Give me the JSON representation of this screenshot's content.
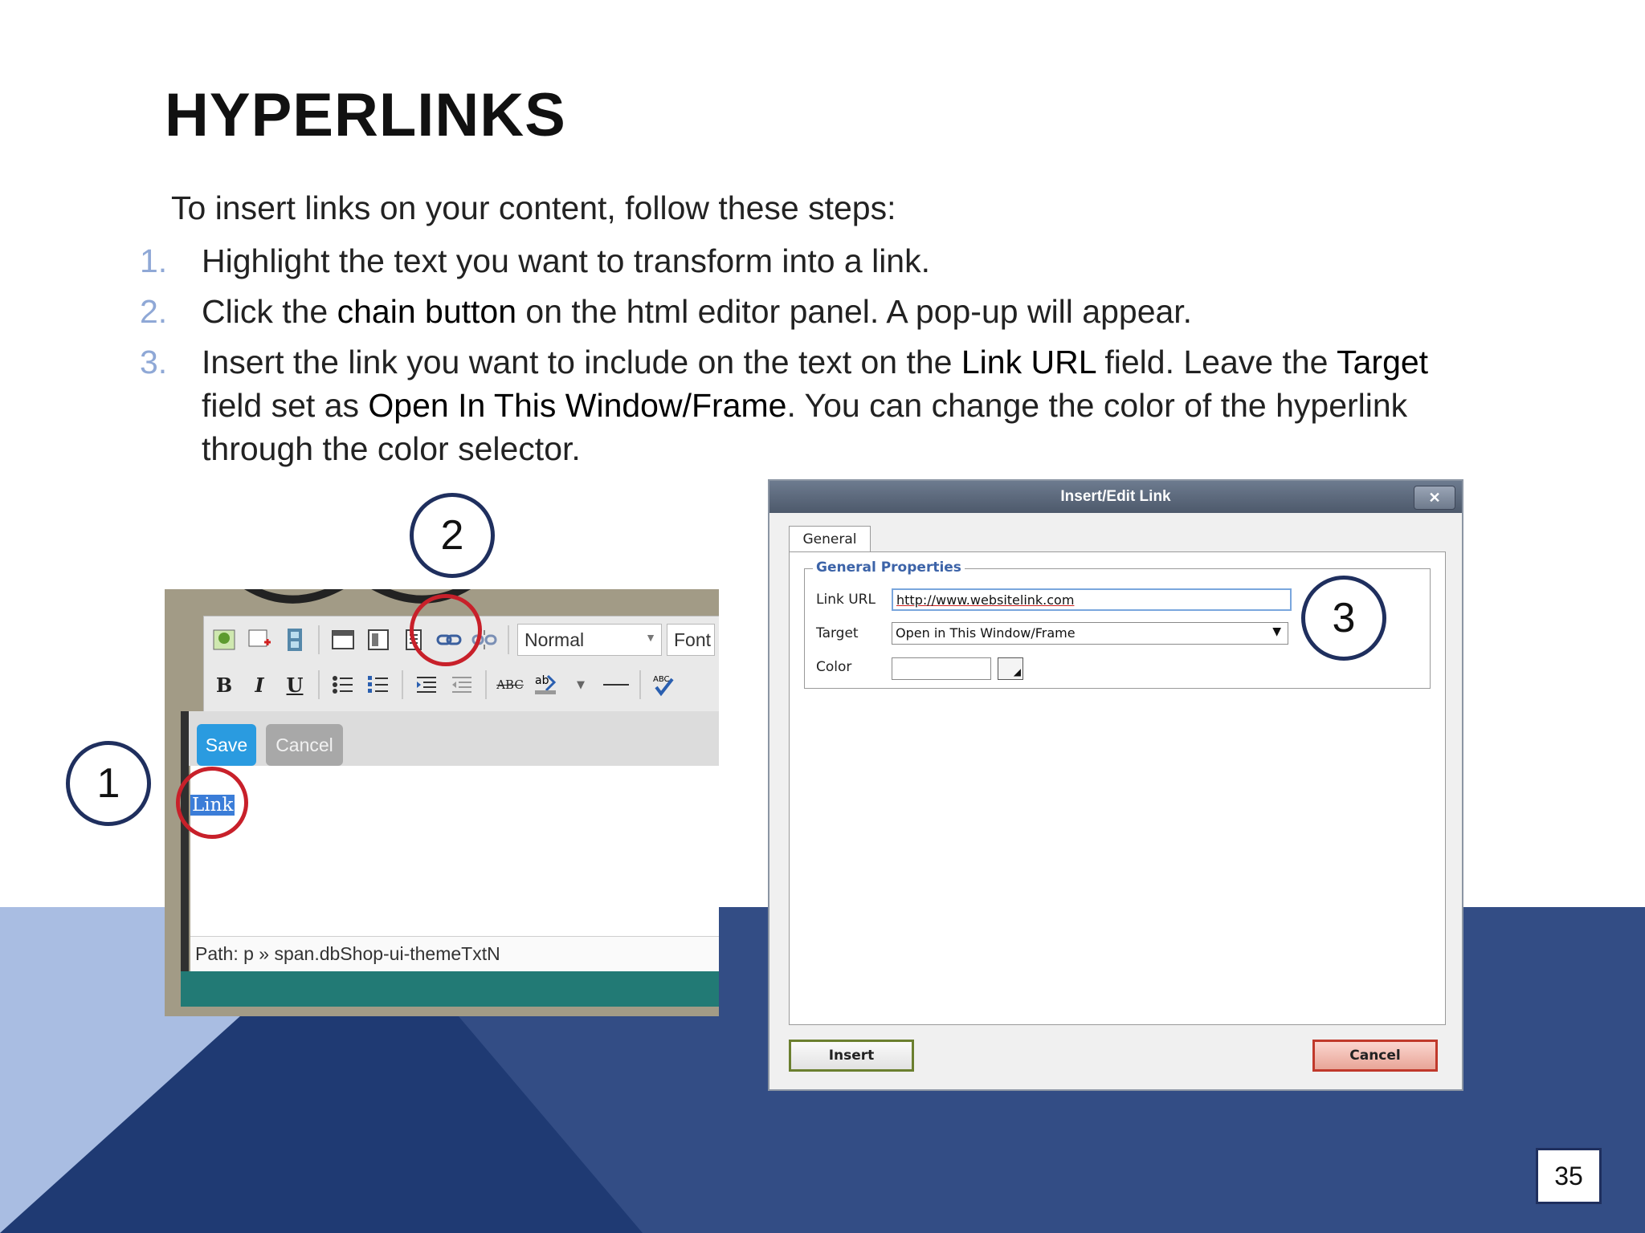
{
  "slide": {
    "title": "HYPERLINKS",
    "intro": "To insert links on your content, follow these steps:",
    "steps": [
      {
        "num": "1.",
        "parts": [
          "Highlight the text you want to transform into a link."
        ]
      },
      {
        "num": "2.",
        "parts": [
          "Click the ",
          "chain button",
          " on the html editor panel. A pop-up will appear."
        ]
      },
      {
        "num": "3.",
        "parts": [
          "Insert the link you want to include on the text on the ",
          "Link URL",
          " field. Leave the ",
          "Target",
          " field set as ",
          "Open In This Window/Frame",
          ". You can change the color of the hyperlink through the color selector."
        ]
      }
    ],
    "callouts": [
      "1",
      "2",
      "3"
    ],
    "page_number": "35",
    "colors": {
      "dark_navy": "#1f3a73",
      "mid_navy": "#334d85",
      "light_blue": "#a9bde2",
      "list_number": "#8fa8d6",
      "callout_ring": "#1f2f5e",
      "highlight_ring": "#c8202a"
    }
  },
  "editor": {
    "style_select": "Normal",
    "font_select": "Font",
    "save_label": "Save",
    "cancel_label": "Cancel",
    "selected_text": "Link",
    "path": "Path: p » span.dbShop-ui-themeTxtN",
    "format_buttons": {
      "bold": "B",
      "italic": "I",
      "underline": "U",
      "spell": "ABC"
    },
    "toolbar_icons": [
      "image-icon",
      "insert-image-icon",
      "film-icon",
      "table-icon",
      "form-icon",
      "anchor-icon",
      "chain-link-icon",
      "unlink-icon",
      "bold-icon",
      "italic-icon",
      "underline-icon",
      "bullet-list-icon",
      "numbered-list-icon",
      "indent-icon",
      "outdent-icon",
      "spellcheck-icon",
      "highlight-color-icon",
      "horizontal-rule-icon",
      "spell-check-mark-icon"
    ]
  },
  "dialog": {
    "title": "Insert/Edit Link",
    "close_label": "✕",
    "tab": "General",
    "legend": "General Properties",
    "link_url_label": "Link URL",
    "link_url_value": "http://www.websitelink.com",
    "target_label": "Target",
    "target_value": "Open in This Window/Frame",
    "color_label": "Color",
    "insert_label": "Insert",
    "cancel_label": "Cancel"
  }
}
